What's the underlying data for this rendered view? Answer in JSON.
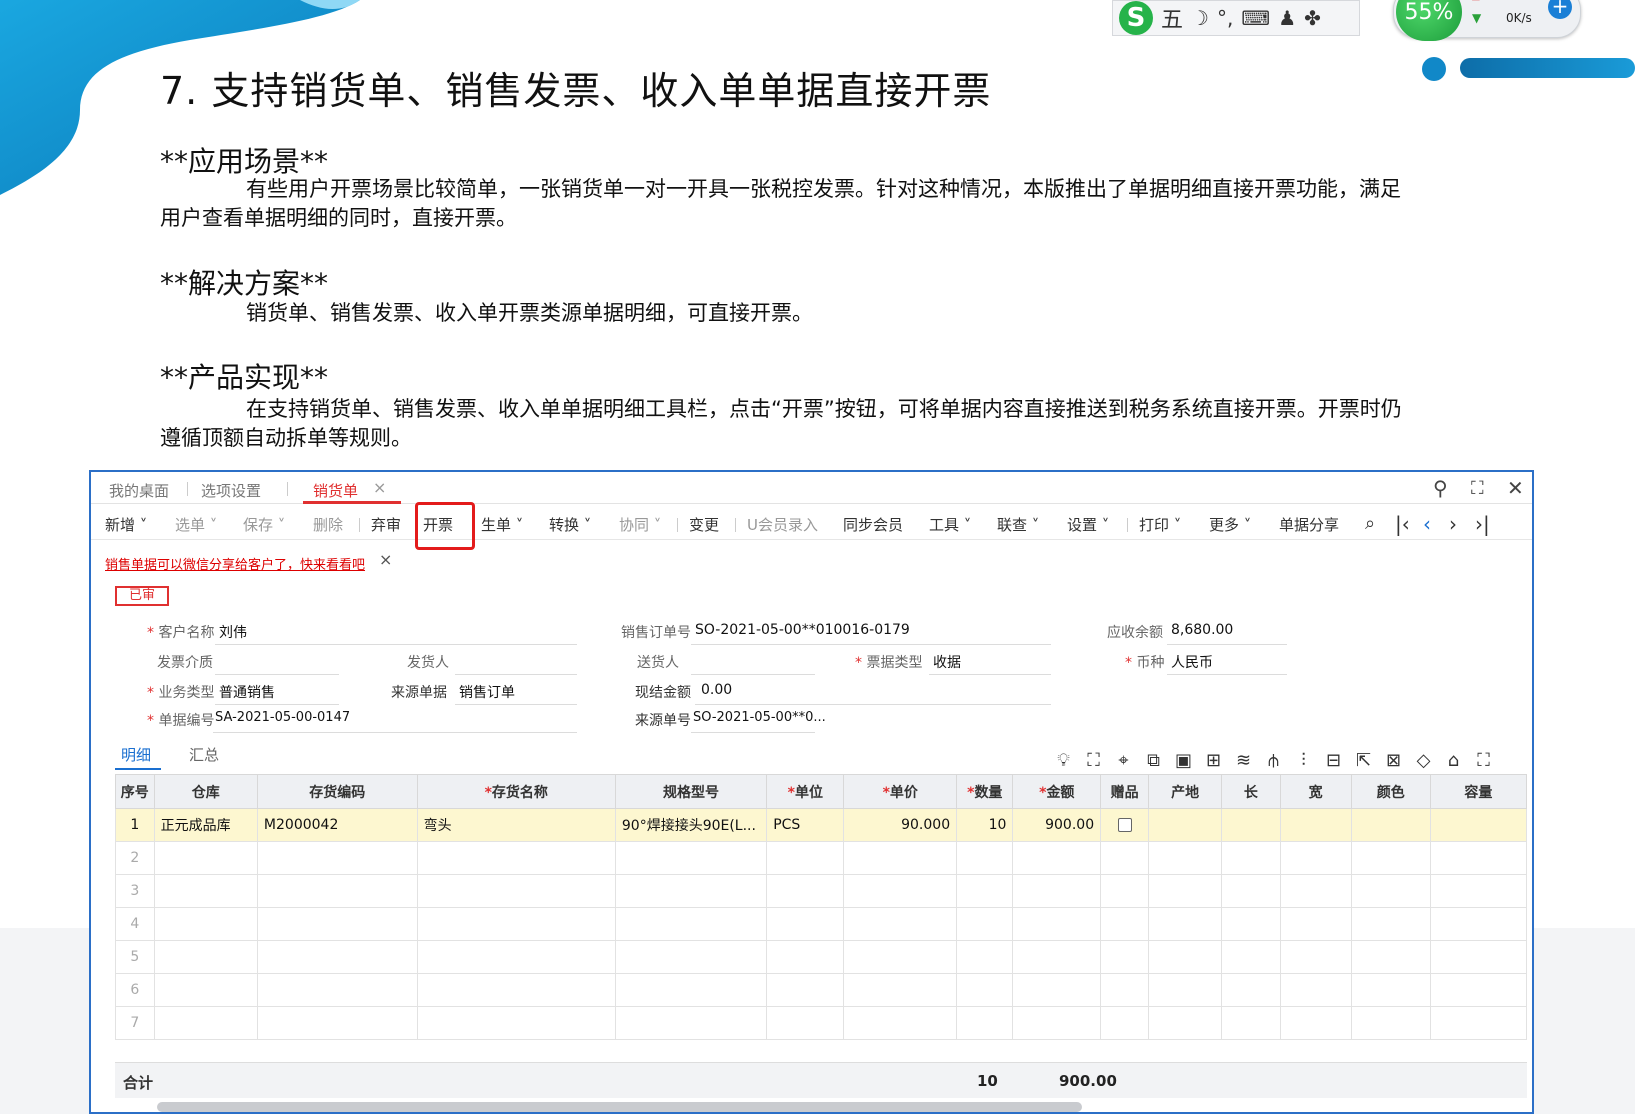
{
  "slide": {
    "title": "7. 支持销货单、销售发票、收入单单据直接开票",
    "sections": [
      {
        "heading": "**应用场景**",
        "body": "有些用户开票场景比较简单，一张销货单一对一开具一张税控发票。针对这种情况，本版推出了单据明细直接开票功能，满足用户查看单据明细的同时，直接开票。"
      },
      {
        "heading": "**解决方案**",
        "body": "销货单、销售发票、收入单开票类源单据明细，可直接开票。"
      },
      {
        "heading": "**产品实现**",
        "body": "在支持销货单、销售发票、收入单单据明细工具栏，点击“开票”按钮，可将单据内容直接推送到税务系统直接开票。开票时仍遵循顶额自动拆单等规则。"
      }
    ]
  },
  "overlay": {
    "ime": {
      "mode": "五",
      "icons": [
        "moon-icon",
        "punctuation-icon",
        "keyboard-icon",
        "user-icon",
        "grid-icon"
      ]
    },
    "net": {
      "percent": "55%",
      "speed": "0K/s"
    }
  },
  "app": {
    "tabs": [
      "我的桌面",
      "选项设置",
      "销货单"
    ],
    "toolbar": {
      "new": "新增",
      "select": "选单",
      "save": "保存",
      "delete": "删除",
      "abandon": "弃审",
      "invoice": "开票",
      "generate": "生单",
      "convert": "转换",
      "collab": "协同",
      "change": "变更",
      "member_entry": "U会员录入",
      "sync_member": "同步会员",
      "tools": "工具",
      "linked_query": "联查",
      "settings": "设置",
      "print": "打印",
      "more": "更多",
      "share": "单据分享"
    },
    "notice": "销售单据可以微信分享给客户了，快来看看吧",
    "status": "已审",
    "form": {
      "customer_label": "客户名称",
      "customer": "刘伟",
      "sales_order_label": "销售订单号",
      "sales_order": "SO-2021-05-00**010016-0179",
      "receivable_label": "应收余额",
      "receivable": "8,680.00",
      "invoice_medium_label": "发票介质",
      "invoice_medium": "",
      "shipper_label": "发货人",
      "shipper": "",
      "deliverer_label": "送货人",
      "deliverer": "",
      "bill_type_label": "票据类型",
      "bill_type": "收据",
      "currency_label": "币种",
      "currency": "人民币",
      "biz_type_label": "业务类型",
      "biz_type": "普通销售",
      "source_doc_label": "来源单据",
      "source_doc": "销售订单",
      "cash_label": "现结金额",
      "cash": "0.00",
      "doc_no_label": "单据编号",
      "doc_no": "SA-2021-05-00-0147",
      "source_no_label": "来源单号",
      "source_no": "SO-2021-05-00**0..."
    },
    "subtabs": [
      "明细",
      "汇总"
    ],
    "grid_icons": [
      "lightbulb-icon",
      "scan-icon",
      "location-icon",
      "copy-row-icon",
      "paste-icon",
      "batch-icon",
      "filter-icon",
      "split-icon",
      "chart-icon",
      "layout-icon",
      "export-icon",
      "columns-icon",
      "tag-icon",
      "warehouse-icon",
      "fullscreen-icon"
    ],
    "grid": {
      "headers": [
        "序号",
        "仓库",
        "存货编码",
        "存货名称",
        "规格型号",
        "单位",
        "单价",
        "数量",
        "金额",
        "赠品",
        "产地",
        "长",
        "宽",
        "颜色",
        "容量"
      ],
      "required": [
        false,
        false,
        false,
        true,
        false,
        true,
        true,
        true,
        true,
        false,
        false,
        false,
        false,
        false,
        false
      ],
      "rows": [
        [
          "1",
          "正元成品库",
          "M2000042",
          "弯头",
          "90°焊接接头90E(L...",
          "PCS",
          "90.000",
          "10",
          "900.00",
          "",
          "",
          "",
          "",
          "",
          ""
        ],
        [
          "2",
          "",
          "",
          "",
          "",
          "",
          "",
          "",
          "",
          "",
          "",
          "",
          "",
          "",
          ""
        ],
        [
          "3",
          "",
          "",
          "",
          "",
          "",
          "",
          "",
          "",
          "",
          "",
          "",
          "",
          "",
          ""
        ],
        [
          "4",
          "",
          "",
          "",
          "",
          "",
          "",
          "",
          "",
          "",
          "",
          "",
          "",
          "",
          ""
        ],
        [
          "5",
          "",
          "",
          "",
          "",
          "",
          "",
          "",
          "",
          "",
          "",
          "",
          "",
          "",
          ""
        ],
        [
          "6",
          "",
          "",
          "",
          "",
          "",
          "",
          "",
          "",
          "",
          "",
          "",
          "",
          "",
          ""
        ],
        [
          "7",
          "",
          "",
          "",
          "",
          "",
          "",
          "",
          "",
          "",
          "",
          "",
          "",
          "",
          ""
        ]
      ]
    },
    "totals": {
      "label": "合计",
      "qty": "10",
      "amount": "900.00"
    }
  }
}
